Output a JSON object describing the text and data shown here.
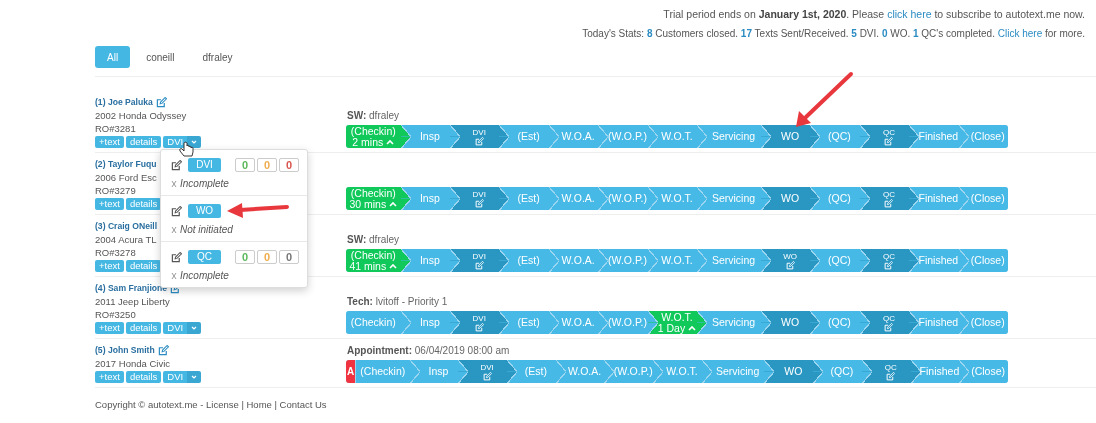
{
  "notice": {
    "before": "Trial period ends on **January 1st, 2020**. Please ",
    "link": "click here",
    "after": " to subscribe to autotext.me now."
  },
  "stats": {
    "before": "Today's Stats: **8** Customers closed. **17** Texts Sent/Received. **5** DVI. **0** WO. **1** QC's completed. ",
    "link": "Click here",
    "after": " for more."
  },
  "tabs": [
    {
      "label": "All",
      "selected": true
    },
    {
      "label": "coneill",
      "selected": false
    },
    {
      "label": "dfraley",
      "selected": false
    }
  ],
  "customers": [
    {
      "name": "(1) Joe Paluka",
      "vehicle": "2002 Honda Odyssey",
      "ro": "RO#3281",
      "text_button": "+text",
      "details_button": "details",
      "dvi_button": "DVI",
      "note": "**SW:** dfraley",
      "steps": [
        {
          "label": "(Checkin)",
          "kind": "current",
          "time": "2 mins"
        },
        {
          "label": "Insp",
          "kind": "plain"
        },
        {
          "label": "DVI",
          "kind": "document",
          "icon": true
        },
        {
          "label": "(Est)",
          "kind": "plain"
        },
        {
          "label": "W.O.A.",
          "kind": "plain"
        },
        {
          "label": "(W.O.P.)",
          "kind": "plain"
        },
        {
          "label": "W.O.T.",
          "kind": "plain"
        },
        {
          "label": "Servicing",
          "kind": "plain"
        },
        {
          "label": "WO",
          "kind": "document"
        },
        {
          "label": "(QC)",
          "kind": "plain"
        },
        {
          "label": "QC",
          "kind": "document",
          "icon": true
        },
        {
          "label": "Finished",
          "kind": "plain"
        },
        {
          "label": "(Close)",
          "kind": "plain"
        }
      ]
    },
    {
      "name": "(2) Taylor Fuqu",
      "vehicle": "2006 Ford Esc",
      "ro": "RO#3279",
      "text_button": "+text",
      "details_button": "details",
      "steps": [
        {
          "label": "(Checkin)",
          "kind": "current",
          "time": "30 mins"
        },
        {
          "label": "Insp",
          "kind": "plain"
        },
        {
          "label": "DVI",
          "kind": "document",
          "icon": true
        },
        {
          "label": "(Est)",
          "kind": "plain"
        },
        {
          "label": "W.O.A.",
          "kind": "plain"
        },
        {
          "label": "(W.O.P.)",
          "kind": "plain"
        },
        {
          "label": "W.O.T.",
          "kind": "plain"
        },
        {
          "label": "Servicing",
          "kind": "plain"
        },
        {
          "label": "WO",
          "kind": "document"
        },
        {
          "label": "(QC)",
          "kind": "plain"
        },
        {
          "label": "QC",
          "kind": "document",
          "icon": true
        },
        {
          "label": "Finished",
          "kind": "plain"
        },
        {
          "label": "(Close)",
          "kind": "plain"
        }
      ]
    },
    {
      "name": "(3) Craig ONeill",
      "vehicle": "2004 Acura TL",
      "ro": "RO#3278",
      "text_button": "+text",
      "details_button": "details",
      "note": "**SW:** dfraley",
      "steps": [
        {
          "label": "(Checkin)",
          "kind": "current",
          "time": "41 mins"
        },
        {
          "label": "Insp",
          "kind": "plain"
        },
        {
          "label": "DVI",
          "kind": "document",
          "icon": true
        },
        {
          "label": "(Est)",
          "kind": "plain"
        },
        {
          "label": "W.O.A.",
          "kind": "plain"
        },
        {
          "label": "(W.O.P.)",
          "kind": "plain"
        },
        {
          "label": "W.O.T.",
          "kind": "plain"
        },
        {
          "label": "Servicing",
          "kind": "plain"
        },
        {
          "label": "WO",
          "kind": "document",
          "icon": true
        },
        {
          "label": "(QC)",
          "kind": "plain"
        },
        {
          "label": "QC",
          "kind": "document",
          "icon": true
        },
        {
          "label": "Finished",
          "kind": "plain"
        },
        {
          "label": "(Close)",
          "kind": "plain"
        }
      ]
    },
    {
      "name": "(4) Sam Franjione",
      "vehicle": "2011 Jeep Liberty",
      "ro": "RO#3250",
      "text_button": "+text",
      "details_button": "details",
      "dvi_button": "DVI",
      "note": "**Tech:** lvitoff - Priority 1",
      "steps": [
        {
          "label": "(Checkin)",
          "kind": "plain"
        },
        {
          "label": "Insp",
          "kind": "plain"
        },
        {
          "label": "DVI",
          "kind": "document",
          "icon": true
        },
        {
          "label": "(Est)",
          "kind": "plain"
        },
        {
          "label": "W.O.A.",
          "kind": "plain"
        },
        {
          "label": "(W.O.P.)",
          "kind": "plain"
        },
        {
          "label": "W.O.T.",
          "kind": "current",
          "time": "1 Day"
        },
        {
          "label": "Servicing",
          "kind": "plain"
        },
        {
          "label": "WO",
          "kind": "document"
        },
        {
          "label": "(QC)",
          "kind": "plain"
        },
        {
          "label": "QC",
          "kind": "document",
          "icon": true
        },
        {
          "label": "Finished",
          "kind": "plain"
        },
        {
          "label": "(Close)",
          "kind": "plain"
        }
      ]
    },
    {
      "name": "(5) John Smith",
      "vehicle": "2017 Honda Civic",
      "text_button": "+text",
      "details_button": "details",
      "dvi_button": "DVI",
      "note": "**Appointment:** 06/04/2019 08:00 am",
      "flag": "A",
      "steps": [
        {
          "label": "(Checkin)",
          "kind": "plain"
        },
        {
          "label": "Insp",
          "kind": "plain"
        },
        {
          "label": "DVI",
          "kind": "document",
          "icon": true
        },
        {
          "label": "(Est)",
          "kind": "plain"
        },
        {
          "label": "W.O.A.",
          "kind": "plain"
        },
        {
          "label": "(W.O.P.)",
          "kind": "plain"
        },
        {
          "label": "W.O.T.",
          "kind": "plain"
        },
        {
          "label": "Servicing",
          "kind": "plain"
        },
        {
          "label": "WO",
          "kind": "document"
        },
        {
          "label": "(QC)",
          "kind": "plain"
        },
        {
          "label": "QC",
          "kind": "document",
          "icon": true
        },
        {
          "label": "Finished",
          "kind": "plain"
        },
        {
          "label": "(Close)",
          "kind": "plain"
        }
      ]
    }
  ],
  "dropdown": {
    "items": [
      {
        "label": "DVI",
        "status": "Incomplete",
        "counts": [
          {
            "value": "0",
            "color": "#5cb85c"
          },
          {
            "value": "0",
            "color": "#f0ad4e"
          },
          {
            "value": "0",
            "color": "#d9534f"
          }
        ]
      },
      {
        "label": "WO",
        "status": "Not initiated"
      },
      {
        "label": "QC",
        "status": "Incomplete",
        "counts": [
          {
            "value": "0",
            "color": "#5cb85c"
          },
          {
            "value": "0",
            "color": "#f0ad4e"
          },
          {
            "value": "0",
            "color": "#777777"
          }
        ]
      }
    ]
  },
  "footer": "Copyright © autotext.me - License | Home | Contact Us"
}
